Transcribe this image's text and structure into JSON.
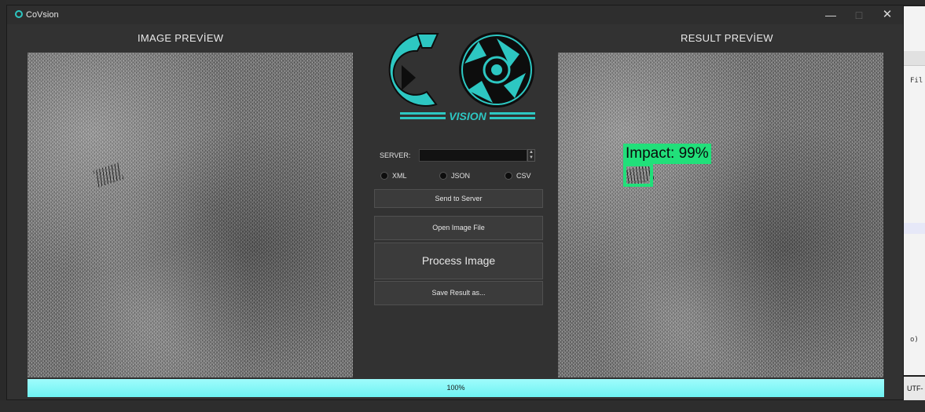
{
  "window": {
    "title": "CoVsion"
  },
  "left_panel": {
    "title": "IMAGE PREVİEW"
  },
  "right_panel": {
    "title": "RESULT PREVİEW",
    "detection_label": "Impact: 99%"
  },
  "logo": {
    "text": "VISION"
  },
  "server": {
    "label": "SERVER:",
    "value": ""
  },
  "formats": [
    {
      "label": "XML",
      "selected": false
    },
    {
      "label": "JSON",
      "selected": false
    },
    {
      "label": "CSV",
      "selected": false
    }
  ],
  "buttons": {
    "send": "Send to Server",
    "open": "Open Image File",
    "process": "Process Image",
    "save": "Save Result as..."
  },
  "progress": {
    "value": 1.0,
    "label": "100%"
  },
  "background": {
    "right_code_1": "Fil",
    "right_code_2": "o)",
    "status_encoding": "UTF-"
  },
  "colors": {
    "accent": "#2dc7c2",
    "progress": "#7ef6f6",
    "detection": "#21e07a",
    "window_bg": "#323232"
  }
}
